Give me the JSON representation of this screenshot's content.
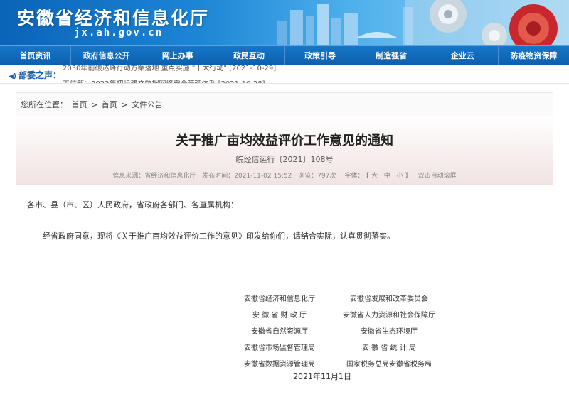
{
  "header": {
    "title": "安徽省经济和信息化厅",
    "domain": "jx.ah.gov.cn"
  },
  "nav": {
    "items": [
      "首页资讯",
      "政府信息公开",
      "网上办事",
      "政民互动",
      "政策引导",
      "制造强省",
      "企业云",
      "防疫物资保障"
    ]
  },
  "ticker": {
    "label": "部委之声：",
    "lines": [
      "2030年前碳达峰行动方案落地 重点实施 \"十大行动\"  [2021-10-29]",
      "工信部：2022年初步建立数据网络安全管理体系  [2021-10-28]"
    ]
  },
  "breadcrumb": {
    "prefix": "您所在位置：",
    "items": [
      "首页",
      "首页",
      "文件公告"
    ],
    "separator": ">"
  },
  "article": {
    "title": "关于推广亩均效益评价工作意见的通知",
    "number": "皖经信运行〔2021〕108号",
    "meta": {
      "source": "信息来源：省经济和信息化厅",
      "published": "发布时间：2021-11-02 15:52",
      "views": "浏览：797次",
      "font_label": "字体：",
      "font_big": "大",
      "font_mid": "中",
      "font_small": "小",
      "scroll": "双击自动滚屏"
    },
    "salutation": "各市、县（市、区）人民政府，省政府各部门、各直属机构：",
    "body": "经省政府同意，现将《关于推广亩均效益评价工作的意见》印发给你们，请结合实际，认真贯彻落实。",
    "signatures": [
      {
        "left": "安徽省经济和信息化厅",
        "right": "安徽省发展和改革委员会"
      },
      {
        "left": "安 徽 省 财 政 厅",
        "right": "安徽省人力资源和社会保障厅"
      },
      {
        "left": "安徽省自然资源厅",
        "right": "安徽省生态环境厅"
      },
      {
        "left": "安徽省市场监督管理局",
        "right": "安 徽 省 统 计 局"
      },
      {
        "left": "安徽省数据资源管理局",
        "right": "国家税务总局安徽省税务局"
      }
    ],
    "date": "2021年11月1日"
  },
  "colors": {
    "nav_bg": "#0d5fae",
    "header_start": "#0a63b8",
    "accent_red": "#c8282d"
  }
}
